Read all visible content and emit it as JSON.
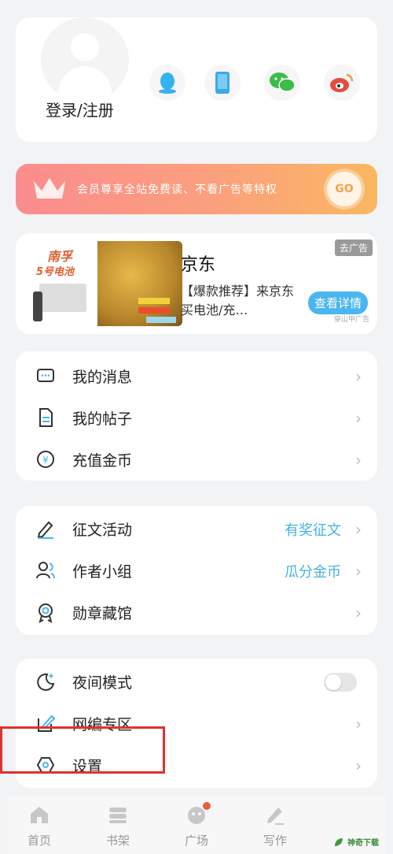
{
  "profile": {
    "login_label": "登录/注册"
  },
  "social": [
    {
      "name": "qq-icon",
      "color": "#35b2ef"
    },
    {
      "name": "phone-icon",
      "color": "#39a9ea"
    },
    {
      "name": "wechat-icon",
      "color": "#3cbc48"
    },
    {
      "name": "weibo-icon",
      "color": "#e84a3d"
    }
  ],
  "vip": {
    "text": "会员尊享全站免费读、不看广告等特权",
    "go_label": "GO"
  },
  "ad": {
    "title": "京东",
    "desc": "【爆款推荐】来京东买电池/充…",
    "tag": "去广告",
    "button": "查看详情",
    "source": "穿山甲广告",
    "image_text_1": "南孚",
    "image_text_2": "5号电池"
  },
  "menu1": [
    {
      "label": "我的消息",
      "icon": "message-icon"
    },
    {
      "label": "我的帖子",
      "icon": "document-icon"
    },
    {
      "label": "充值金币",
      "icon": "coin-icon"
    }
  ],
  "menu2": [
    {
      "label": "征文活动",
      "extra": "有奖征文",
      "icon": "pen-icon"
    },
    {
      "label": "作者小组",
      "extra": "瓜分金币",
      "icon": "group-icon"
    },
    {
      "label": "勋章藏馆",
      "extra": "",
      "icon": "medal-icon"
    }
  ],
  "menu3": [
    {
      "label": "夜间模式",
      "icon": "moon-icon"
    },
    {
      "label": "网编专区",
      "icon": "edit-icon"
    },
    {
      "label": "设置",
      "icon": "settings-icon"
    }
  ],
  "night_mode": {
    "on": false
  },
  "tabs": [
    {
      "label": "首页",
      "icon": "home-icon"
    },
    {
      "label": "书架",
      "icon": "bookshelf-icon"
    },
    {
      "label": "广场",
      "icon": "square-icon"
    },
    {
      "label": "写作",
      "icon": "write-icon"
    }
  ],
  "watermark": "神奇下载",
  "accent": "#46b3e0"
}
